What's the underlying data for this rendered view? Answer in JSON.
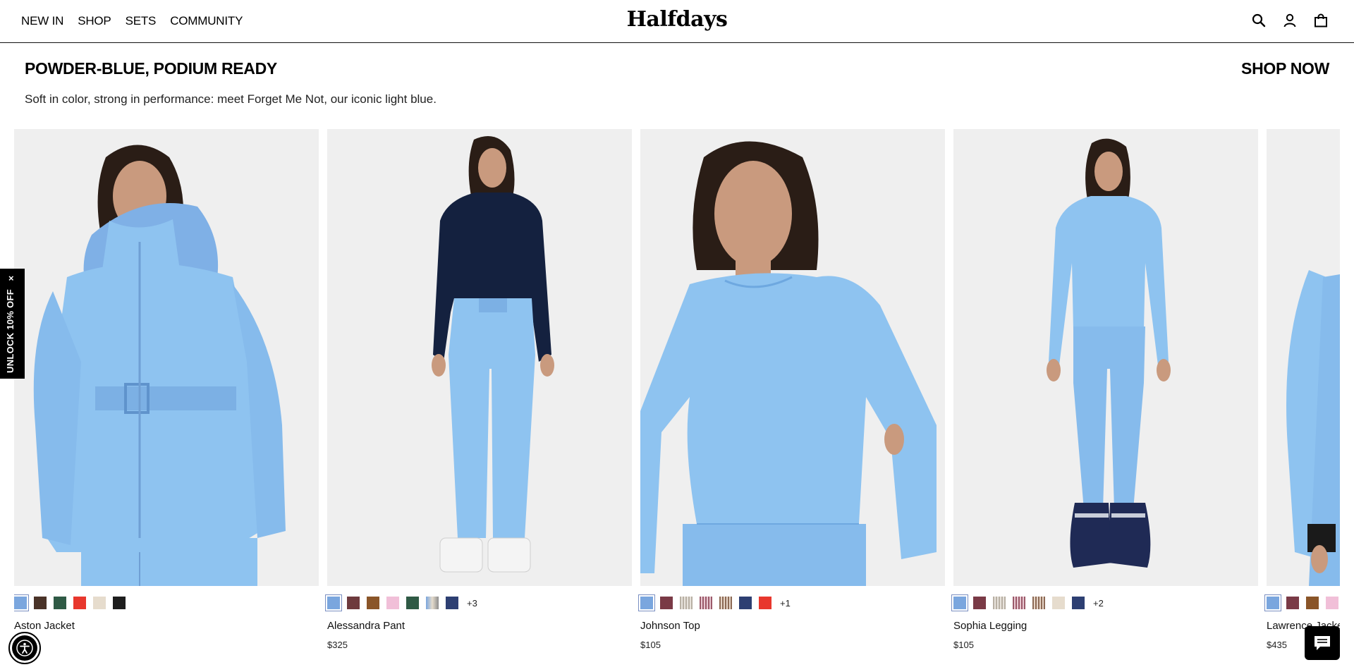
{
  "header": {
    "nav": [
      "NEW IN",
      "SHOP",
      "SETS",
      "COMMUNITY"
    ],
    "logo": "Halfdays",
    "icons": [
      "search-icon",
      "account-icon",
      "bag-icon"
    ]
  },
  "section": {
    "title": "POWDER-BLUE, PODIUM READY",
    "cta": "SHOP NOW",
    "subtitle": "Soft in color, strong in performance: meet Forget Me Not, our iconic light blue."
  },
  "products": [
    {
      "name": "Aston Jacket",
      "price": "",
      "swatches": [
        "#7aa6de",
        "#4a3328",
        "#2f5a45",
        "#e8372d",
        "#e6dccd",
        "#1e1e1e"
      ],
      "more": ""
    },
    {
      "name": "Alessandra Pant",
      "price": "$325",
      "swatches": [
        "#7aa6de",
        "#6e3a3d",
        "#8a5528",
        "#f1bfd8",
        "#2f5a45",
        "#b2a99a",
        "#2d3f72"
      ],
      "more": "+3"
    },
    {
      "name": "Johnson Top",
      "price": "$105",
      "swatches": [
        "#7aa6de",
        "#7a3a46",
        "#b8b0a4",
        "#9b5a6a",
        "#8c6a55",
        "#2d3f72",
        "#e8372d"
      ],
      "more": "+1"
    },
    {
      "name": "Sophia Legging",
      "price": "$105",
      "swatches": [
        "#7aa6de",
        "#7a3a46",
        "#b8b0a4",
        "#9b5a6a",
        "#8c6a55",
        "#e6dccd",
        "#2d3f72"
      ],
      "more": "+2"
    },
    {
      "name": "Lawrence Jacket",
      "price": "$435",
      "swatches": [
        "#7aa6de",
        "#7a3a46",
        "#8a5528",
        "#f1bfd8"
      ],
      "more": ""
    }
  ],
  "promo": {
    "close": "×",
    "label": "UNLOCK 10% OFF"
  },
  "colors": {
    "model_blue": "#8ec3f0",
    "model_navy": "#14213f",
    "image_bg": "#efefef",
    "skin": "#c99a7e",
    "hair": "#2a1d16"
  }
}
